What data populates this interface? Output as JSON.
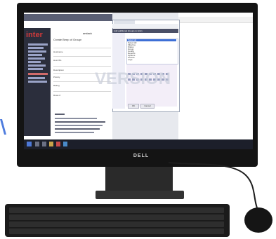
{
  "accent_color": "#4f7dde",
  "device": {
    "brand": "DELL"
  },
  "left_app": {
    "logo_text": "inter",
    "brand": "arstack",
    "title": "Create Beep of Groups",
    "rows": [
      {
        "label": "Hostname"
      },
      {
        "label": "Host IPs"
      },
      {
        "label": "Description"
      },
      {
        "label": "Priority"
      },
      {
        "label": "Rating"
      },
      {
        "label": "Rows #"
      }
    ]
  },
  "browser": {
    "header_text": "Add additional Groups to Entry",
    "dropdown_items": [
      "Select all",
      "Select All",
      "Filtering",
      "Status",
      "Group",
      "Config",
      "Reports",
      "Options",
      "Access",
      "Logs"
    ],
    "buttons": {
      "ok": "OK",
      "cancel": "Cancel"
    }
  },
  "watermark": "VERSION"
}
